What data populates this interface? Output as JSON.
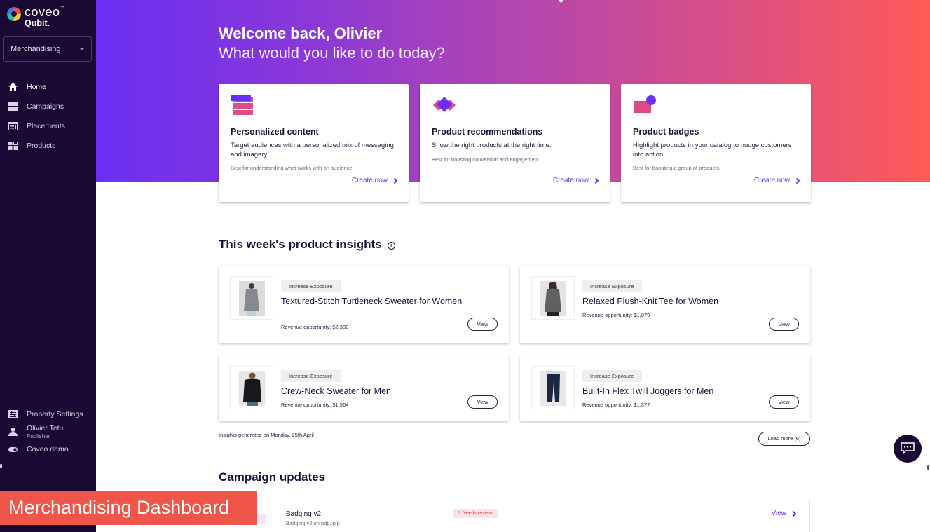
{
  "app": {
    "brand_line1": "coveo",
    "brand_tm": "™",
    "brand_line2": "Qubit.",
    "workspace_selector": "Merchandising"
  },
  "sidebar": {
    "items": [
      {
        "label": "Home",
        "icon": "home-icon",
        "active": true
      },
      {
        "label": "Campaigns",
        "icon": "campaigns-icon"
      },
      {
        "label": "Placements",
        "icon": "placements-icon"
      },
      {
        "label": "Products",
        "icon": "products-icon"
      }
    ],
    "bottom": {
      "settings_label": "Property Settings",
      "user_name": "Olivier Tetu",
      "user_role": "Publisher",
      "property_label": "Coveo demo"
    }
  },
  "hero": {
    "greeting": "Welcome back, Olivier",
    "prompt": "What would you like to do today?",
    "gradient": [
      "#6a2ff2",
      "#b246b0",
      "#ff5b55"
    ]
  },
  "action_cards": [
    {
      "title": "Personalized content",
      "description": "Target audiences with a personalized mix of messaging and imagery.",
      "hint": "Best for understanding what works with an audience.",
      "cta": "Create now",
      "icon": "personalized-content-icon"
    },
    {
      "title": "Product recommendations",
      "description": "Show the right products at the right time.",
      "hint": "Best for boosting conversion and engagement.",
      "cta": "Create now",
      "icon": "recommendations-icon"
    },
    {
      "title": "Product badges",
      "description": "Highlight products in your catalog to nudge customers into action.",
      "hint": "Best for boosting a group of products.",
      "cta": "Create now",
      "icon": "badges-icon"
    }
  ],
  "insights": {
    "title": "This week's product insights",
    "items": [
      {
        "tag": "Increase Exposure",
        "name": "Textured-Stitch Turtleneck Sweater for Women",
        "revenue": "Revenue opportunity: $2,380",
        "action": "View"
      },
      {
        "tag": "Increase Exposure",
        "name": "Relaxed Plush-Knit Tee for Women",
        "revenue": "Revenue opportunity: $1,879",
        "action": "View"
      },
      {
        "tag": "Increase Exposure",
        "name": "Crew-Neck Sweater for Men",
        "revenue": "Revenue opportunity: $1,564",
        "action": "View"
      },
      {
        "tag": "Increase Exposure",
        "name": "Built-In Flex Twill Joggers for Men",
        "revenue": "Revenue opportunity: $1,377",
        "action": "View"
      }
    ],
    "generated_note": "Insights generated on Monday, 25th April",
    "load_more": "Load more (6)"
  },
  "campaigns": {
    "title": "Campaign updates",
    "items": [
      {
        "name": "Badging v2",
        "subtitle": "Badging v2 on pdp, plp",
        "status": "Needs review",
        "status_icon": "!",
        "action": "View"
      }
    ]
  },
  "caption": "Merchandising Dashboard",
  "colors": {
    "sidebar_bg": "#1a0a33",
    "accent": "#6b2ef0",
    "alert": "#e23a3a",
    "caption_bg": "#ef5548"
  }
}
